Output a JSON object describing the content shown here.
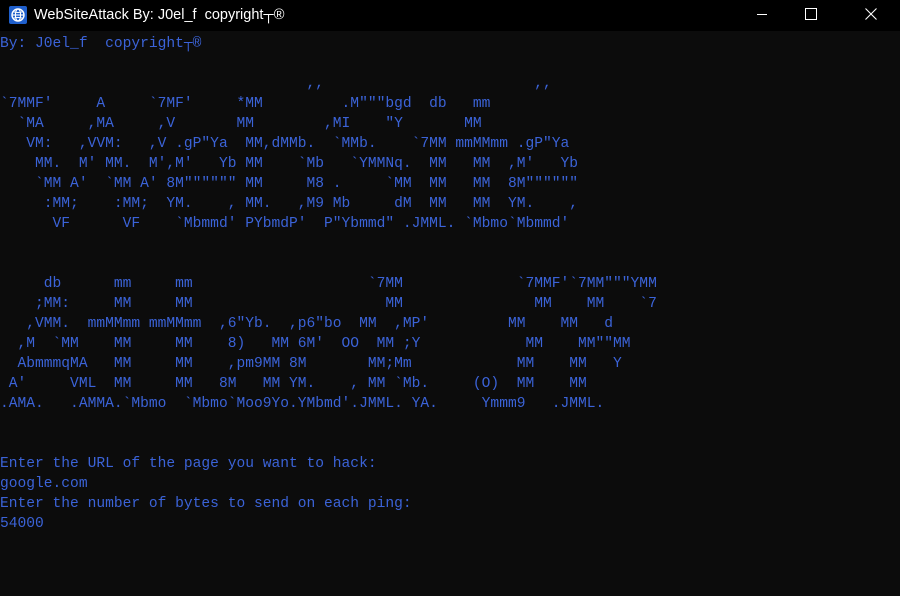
{
  "window": {
    "title": "WebSiteAttack By: J0el_f  copyright┬®",
    "icon": "app-globe-icon",
    "buttons": [
      "minimize-icon",
      "maximize-icon",
      "close-icon"
    ]
  },
  "console": {
    "text_color": "#3b63d8",
    "background": "#0c0c0c",
    "lines": [
      "By: J0el_f  copyright┬®",
      "",
      "                                   ,,                        ,,",
      "`7MMF'     A     `7MF'     *MM         .M\"\"\"bgd  db   mm",
      "  `MA     ,MA     ,V       MM        ,MI    \"Y       MM",
      "   VM:   ,VVM:   ,V .gP\"Ya  MM,dMMb.  `MMb.    `7MM mmMMmm .gP\"Ya",
      "    MM.  M' MM.  M',M'   Yb MM    `Mb   `YMMNq.  MM   MM  ,M'   Yb",
      "    `MM A'  `MM A' 8M\"\"\"\"\"\" MM     M8 .     `MM  MM   MM  8M\"\"\"\"\"\"",
      "     :MM;    :MM;  YM.    , MM.   ,M9 Mb     dM  MM   MM  YM.    ,",
      "      VF      VF    `Mbmmd' PYbmdP'  P\"Ybmmd\" .JMML. `Mbmo`Mbmmd'",
      "",
      "",
      "     db      mm     mm                    `7MM             `7MMF'`7MM\"\"\"YMM",
      "    ;MM:     MM     MM                      MM               MM    MM    `7",
      "   ,VMM.  mmMMmm mmMMmm  ,6\"Yb.  ,p6\"bo  MM  ,MP'         MM    MM   d",
      "  ,M  `MM    MM     MM    8)   MM 6M'  OO  MM ;Y            MM    MM\"\"MM",
      "  AbmmmqMA   MM     MM    ,pm9MM 8M       MM;Mm            MM    MM   Y",
      " A'     VML  MM     MM   8M   MM YM.    , MM `Mb.     (O)  MM    MM",
      ".AMA.   .AMMA.`Mbmo  `Mbmo`Moo9Yo.YMbmd'.JMML. YA.     Ymmm9   .JMML.",
      "",
      "",
      "Enter the URL of the page you want to hack:",
      "google.com",
      "Enter the number of bytes to send on each ping:",
      "54000"
    ]
  }
}
